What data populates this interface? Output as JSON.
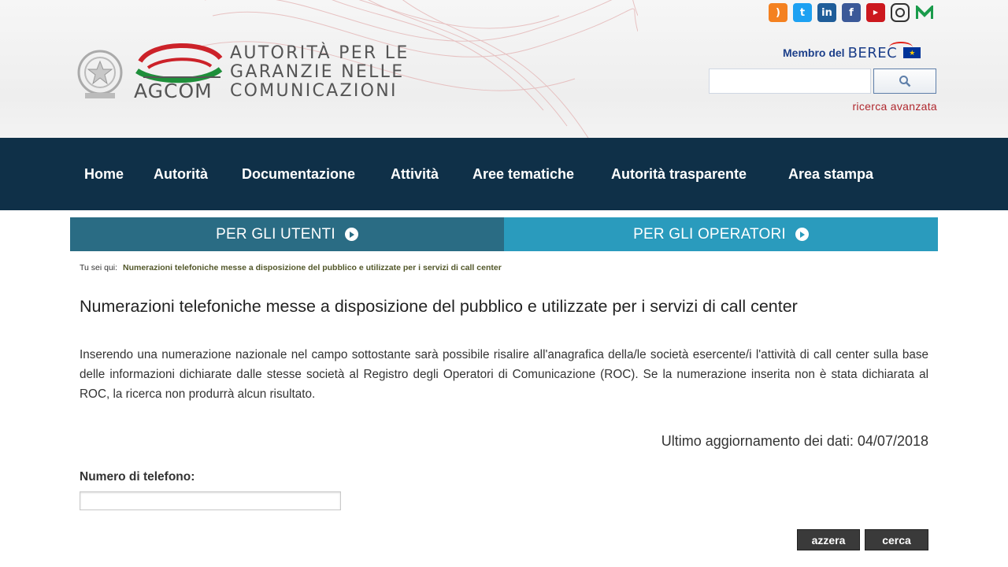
{
  "header": {
    "logo": {
      "short_name": "AGCOM",
      "name_lines": [
        "AUTORITÀ PER LE",
        "GARANZIE NELLE",
        "COMUNICAZIONI"
      ]
    },
    "social_icons": [
      "rss-icon",
      "twitter-icon",
      "linkedin-icon",
      "facebook-icon",
      "youtube-icon",
      "instagram-icon",
      "medium-icon"
    ],
    "berec": {
      "text": "Membro del",
      "logo_text": "BEREC"
    },
    "search": {
      "value": "",
      "placeholder": ""
    },
    "advanced_search": "ricerca avanzata"
  },
  "nav": {
    "items": [
      "Home",
      "Autorità",
      "Documentazione",
      "Attività",
      "Aree tematiche",
      "Autorità trasparente",
      "Area stampa"
    ]
  },
  "tabs": [
    {
      "label": "PER GLI UTENTI",
      "color": "#2a6c84"
    },
    {
      "label": "PER GLI OPERATORI",
      "color": "#2a9bbd"
    }
  ],
  "breadcrumb": {
    "label": "Tu sei qui:",
    "current": "Numerazioni telefoniche messe a disposizione del pubblico e utilizzate per i servizi di call center"
  },
  "main": {
    "title": "Numerazioni telefoniche messe a disposizione del pubblico e utilizzate per i servizi di call center",
    "intro": "Inserendo una numerazione nazionale nel campo sottostante sarà possibile risalire all'anagrafica della/le società esercente/i l'attività di call center sulla base delle informazioni dichiarate dalle stesse società al Registro degli Operatori di Comunicazione (ROC). Se la numerazione inserita non è stata dichiarata al ROC, la ricerca non produrrà alcun risultato.",
    "update_label": "Ultimo aggiornamento dei dati:",
    "update_date": "04/07/2018",
    "phone_label": "Numero di telefono:",
    "phone_value": "",
    "reset_label": "azzera",
    "search_label": "cerca"
  },
  "colors": {
    "nav_background": "#0f3048",
    "accent_red": "#b0282e",
    "button_dark": "#3a3a3a"
  }
}
